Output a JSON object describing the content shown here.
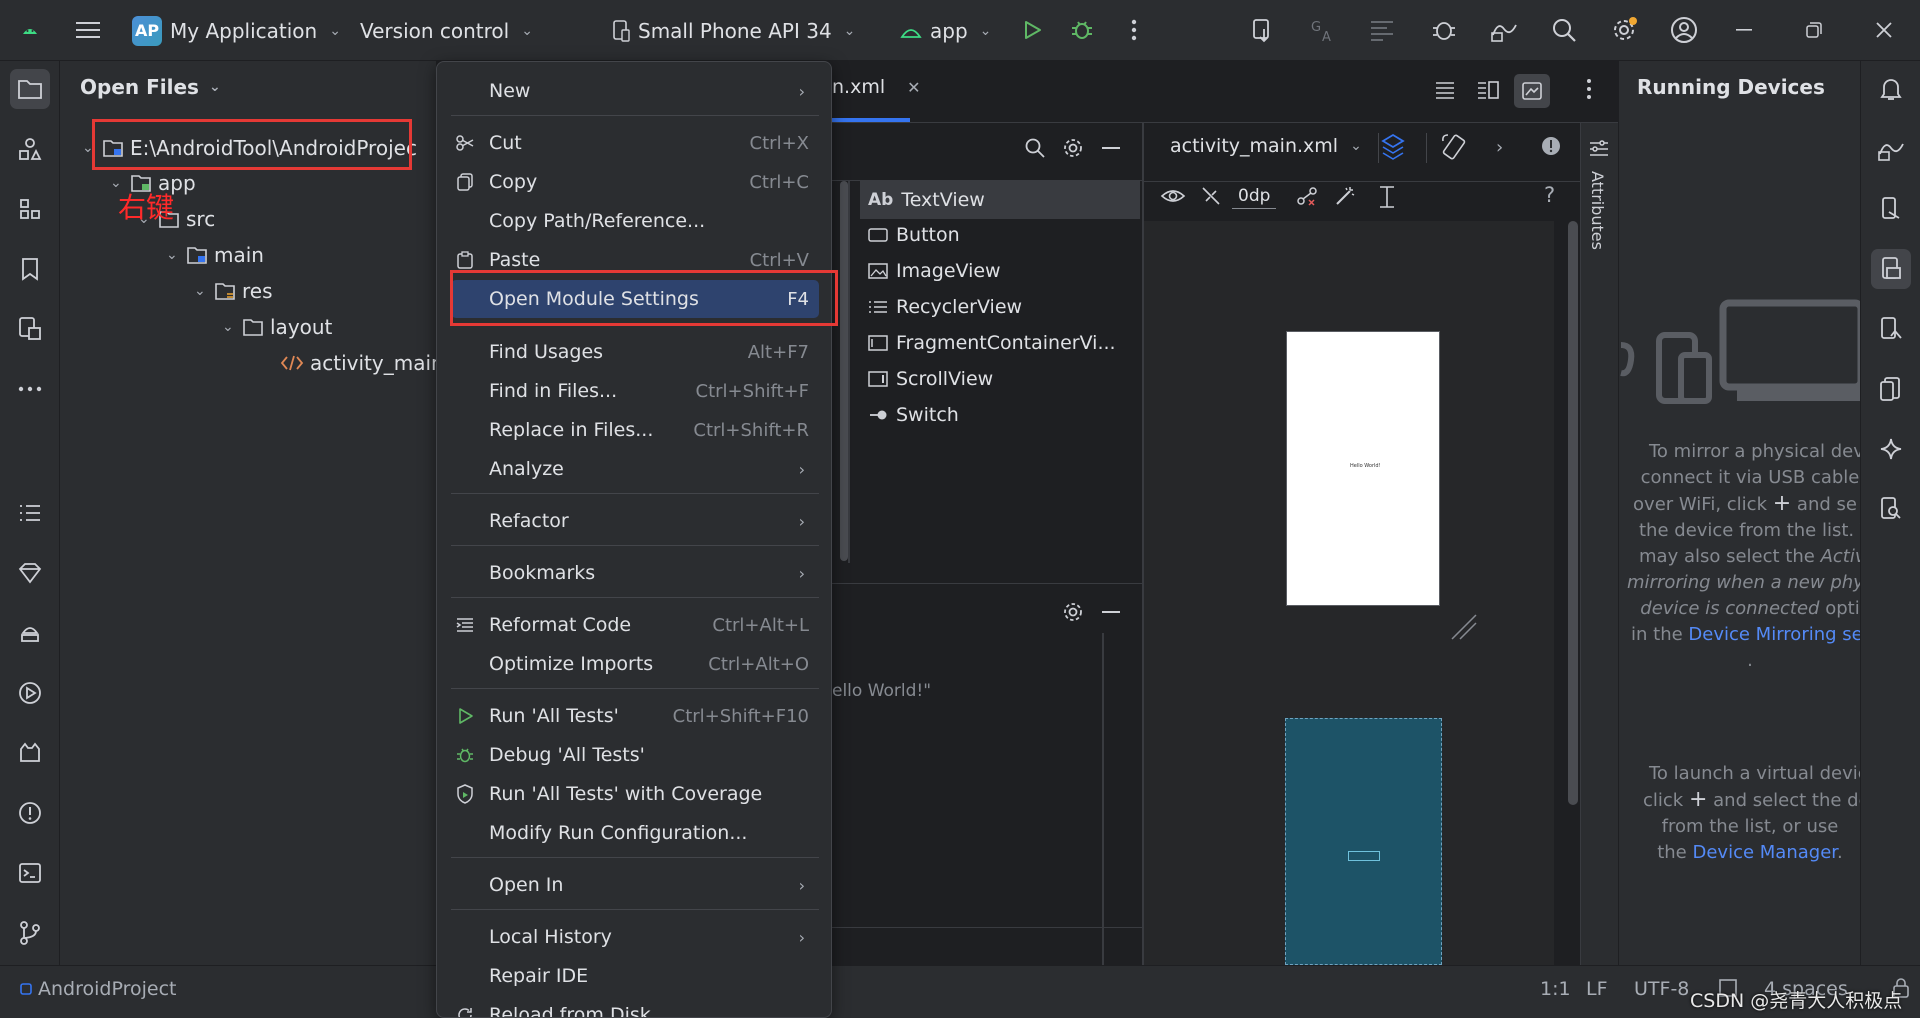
{
  "titlebar": {
    "project_badge": "AP",
    "project_name": "My Application",
    "vcs": "Version control",
    "device": "Small Phone API 34",
    "run_config": "app"
  },
  "project_panel": {
    "title": "Open Files",
    "tree": [
      {
        "label": "E:\\AndroidTool\\AndroidProjec"
      },
      {
        "label": "app"
      },
      {
        "label": "src"
      },
      {
        "label": "main"
      },
      {
        "label": "res"
      },
      {
        "label": "layout"
      },
      {
        "label": "activity_main."
      }
    ],
    "annotation": "右键"
  },
  "editor": {
    "tab_fragment": "n.xml",
    "file_dropdown": "activity_main.xml",
    "margin_value": "0dp",
    "palette": [
      "TextView",
      "Button",
      "ImageView",
      "RecyclerView",
      "FragmentContainerVi...",
      "ScrollView",
      "Switch"
    ],
    "palette_textview_prefix": "Ab",
    "tree_hint": "ello World!\"",
    "attributes_label": "Attributes",
    "preview_text": "Hello World!"
  },
  "context_menu": {
    "items": [
      {
        "label": "New",
        "shortcut": "",
        "submenu": true
      },
      {
        "label": "Cut",
        "shortcut": "Ctrl+X"
      },
      {
        "label": "Copy",
        "shortcut": "Ctrl+C"
      },
      {
        "label": "Copy Path/Reference...",
        "shortcut": ""
      },
      {
        "label": "Paste",
        "shortcut": "Ctrl+V"
      },
      {
        "label": "Open Module Settings",
        "shortcut": "F4"
      },
      {
        "label": "Find Usages",
        "shortcut": "Alt+F7"
      },
      {
        "label": "Find in Files...",
        "shortcut": "Ctrl+Shift+F"
      },
      {
        "label": "Replace in Files...",
        "shortcut": "Ctrl+Shift+R"
      },
      {
        "label": "Analyze",
        "shortcut": "",
        "submenu": true
      },
      {
        "label": "Refactor",
        "shortcut": "",
        "submenu": true
      },
      {
        "label": "Bookmarks",
        "shortcut": "",
        "submenu": true
      },
      {
        "label": "Reformat Code",
        "shortcut": "Ctrl+Alt+L"
      },
      {
        "label": "Optimize Imports",
        "shortcut": "Ctrl+Alt+O"
      },
      {
        "label": "Run 'All Tests'",
        "shortcut": "Ctrl+Shift+F10"
      },
      {
        "label": "Debug 'All Tests'",
        "shortcut": ""
      },
      {
        "label": "Run 'All Tests' with Coverage",
        "shortcut": ""
      },
      {
        "label": "Modify Run Configuration...",
        "shortcut": ""
      },
      {
        "label": "Open In",
        "shortcut": "",
        "submenu": true
      },
      {
        "label": "Local History",
        "shortcut": "",
        "submenu": true
      },
      {
        "label": "Repair IDE",
        "shortcut": ""
      },
      {
        "label": "Reload from Disk",
        "shortcut": ""
      }
    ]
  },
  "running_devices": {
    "title": "Running Devices",
    "line1": "To mirror a physical devi",
    "line2": "connect it via USB cable",
    "line3a": "over WiFi, click",
    "line3b": "and se",
    "line4": "the device from the list. Y",
    "line5a": "may also select the",
    "line5b": "Activ",
    "line6": "mirroring when a new phys",
    "line7a": "device is connected",
    "line7b": "opti",
    "line8a": "in the",
    "line8b": "Device Mirroring set",
    "line9": ".",
    "line10": "To launch a virtual devic",
    "line11a": "click",
    "line11b": "and select the de",
    "line12": "from the list, or use",
    "line13a": "the",
    "line13b": "Device Manager",
    "line13c": "."
  },
  "statusbar": {
    "project": "AndroidProject",
    "position": "1:1",
    "line_sep": "LF",
    "encoding": "UTF-8",
    "indent": "4 spaces",
    "watermark": "CSDN @尧青大人积极点"
  }
}
